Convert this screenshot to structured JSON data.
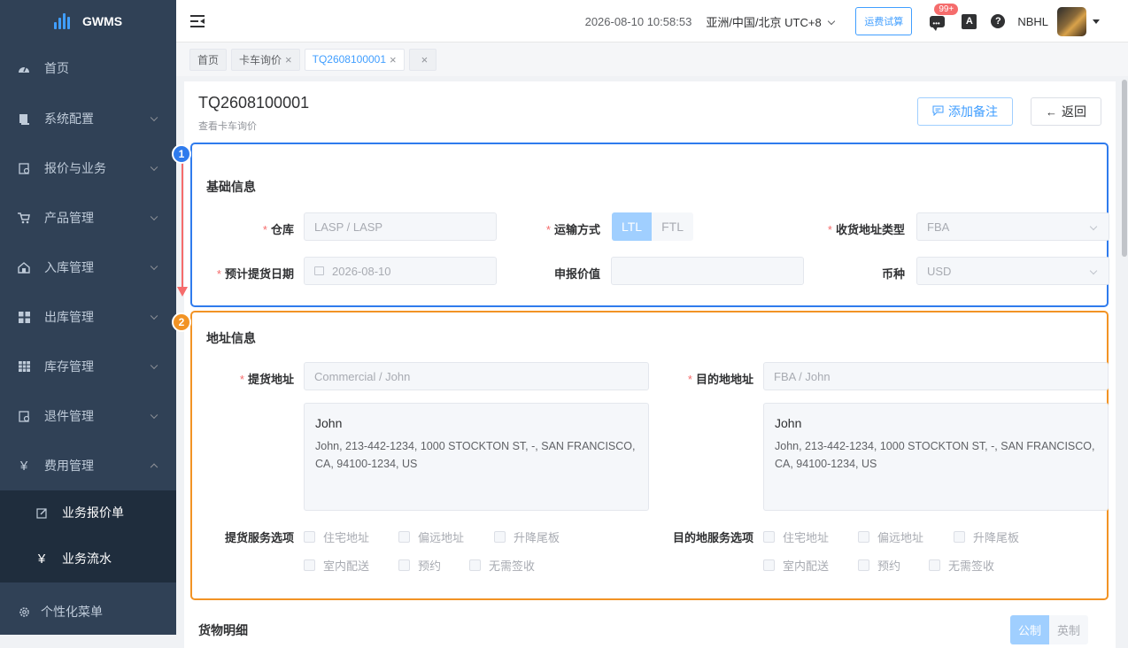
{
  "app": {
    "name": "GWMS"
  },
  "sidebar": {
    "items": [
      {
        "label": "首页",
        "icon": "dashboard-icon"
      },
      {
        "label": "系统配置",
        "icon": "settings-icon"
      },
      {
        "label": "报价与业务",
        "icon": "quote-icon"
      },
      {
        "label": "产品管理",
        "icon": "cart-icon"
      },
      {
        "label": "入库管理",
        "icon": "inbound-icon"
      },
      {
        "label": "出库管理",
        "icon": "outbound-icon"
      },
      {
        "label": "库存管理",
        "icon": "inventory-icon"
      },
      {
        "label": "退件管理",
        "icon": "return-icon"
      },
      {
        "label": "费用管理",
        "icon": "yen-icon"
      }
    ],
    "sub_items": [
      {
        "label": "业务报价单",
        "icon": "edit-icon"
      },
      {
        "label": "业务流水",
        "icon": "yen-icon"
      }
    ],
    "bottom_item": {
      "label": "个性化菜单",
      "icon": "gear-icon"
    }
  },
  "header": {
    "datetime": "2026-08-10 10:58:53",
    "timezone": "亚洲/中国/北京 UTC+8",
    "freight_button": "运费试算",
    "message_badge": "99+",
    "username": "NBHL"
  },
  "tabs": [
    {
      "label": "首页",
      "closable": false
    },
    {
      "label": "卡车询价",
      "closable": true
    },
    {
      "label": "TQ2608100001",
      "closable": true,
      "active": true
    },
    {
      "label": "",
      "closable": true
    }
  ],
  "page": {
    "title": "TQ2608100001",
    "subtitle": "查看卡车询价",
    "add_note_button": "添加备注",
    "back_button": "返回"
  },
  "basic_info": {
    "marker": "1",
    "title": "基础信息",
    "warehouse_label": "仓库",
    "warehouse_value": "LASP / LASP",
    "transport_label": "运输方式",
    "transport_options": [
      "LTL",
      "FTL"
    ],
    "transport_selected": "LTL",
    "address_type_label": "收货地址类型",
    "address_type_value": "FBA",
    "pickup_date_label": "预计提货日期",
    "pickup_date_value": "2026-08-10",
    "declared_value_label": "申报价值",
    "declared_value": "",
    "currency_label": "币种",
    "currency_value": "USD"
  },
  "address_info": {
    "marker": "2",
    "title": "地址信息",
    "pickup_label": "提货地址",
    "pickup_value": "Commercial / John",
    "pickup_name": "John",
    "pickup_detail": "John, 213-442-1234, 1000 STOCKTON ST, -, SAN FRANCISCO, CA, 94100-1234, US",
    "dest_label": "目的地地址",
    "dest_value": "FBA / John",
    "dest_name": "John",
    "dest_detail": "John, 213-442-1234, 1000 STOCKTON ST, -, SAN FRANCISCO, CA, 94100-1234, US",
    "pickup_services_label": "提货服务选项",
    "dest_services_label": "目的地服务选项",
    "service_options": [
      "住宅地址",
      "偏远地址",
      "升降尾板",
      "室内配送",
      "预约",
      "无需签收"
    ]
  },
  "goods": {
    "title": "货物明细",
    "unit_options": [
      "公制",
      "英制"
    ],
    "unit_selected": "公制"
  },
  "colors": {
    "sidebar_bg": "#304156",
    "submenu_bg": "#1f2d3d",
    "accent": "#409eff",
    "section1_border": "#2f7bed",
    "section2_border": "#f29324",
    "required": "#f56c6c"
  }
}
